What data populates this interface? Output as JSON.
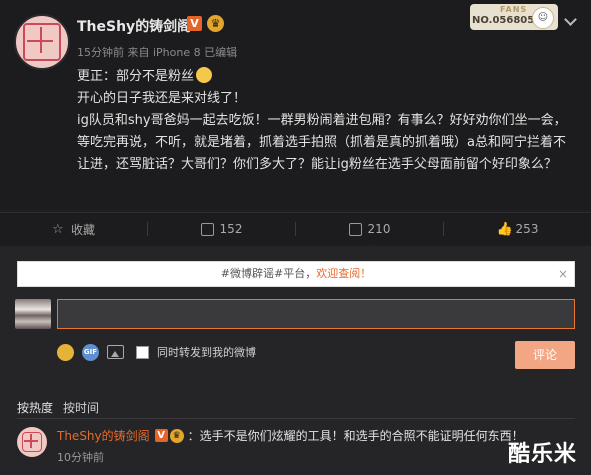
{
  "post": {
    "username": "TheShy的铸剑阁",
    "verified_badge": "V",
    "meta": "15分钟前 来自 iPhone 8 已编辑",
    "fans_card": {
      "label": "FANS",
      "number": "NO.056805"
    },
    "lines": [
      "更正：部分不是粉丝",
      "开心的日子我还是来对线了！",
      "ig队员和shy哥爸妈一起去吃饭！一群男粉闹着进包厢？有事么？好好劝你们坐一会，等吃完再说，不听，就是堵着，抓着选手拍照（抓着是真的抓着哦）a总和阿宁拦着不让进，还骂脏话？大哥们？你们多大了？能让ig粉丝在选手父母面前留个好印象么？"
    ]
  },
  "actions": {
    "favorite": "收藏",
    "repost_count": "152",
    "comment_count": "210",
    "like_count": "253"
  },
  "comments": {
    "notice_prefix": "#微博辟谣#平台，",
    "notice_link": "欢迎查阅！",
    "notice_close": "×",
    "repost_checkbox_label": "同时转发到我的微博",
    "gif_label": "GIF",
    "submit_label": "评论",
    "sort_hot": "按热度",
    "sort_time": "按时间",
    "items": [
      {
        "user": "TheShy的铸剑阁",
        "text": "：选手不是你们炫耀的工具！和选手的合照不能证明任何东西！",
        "time": "10分钟前"
      }
    ]
  },
  "watermark": "酷乐米",
  "colors": {
    "accent": "#e86a2a",
    "background": "#1e1e20",
    "submit": "#f3a684"
  }
}
